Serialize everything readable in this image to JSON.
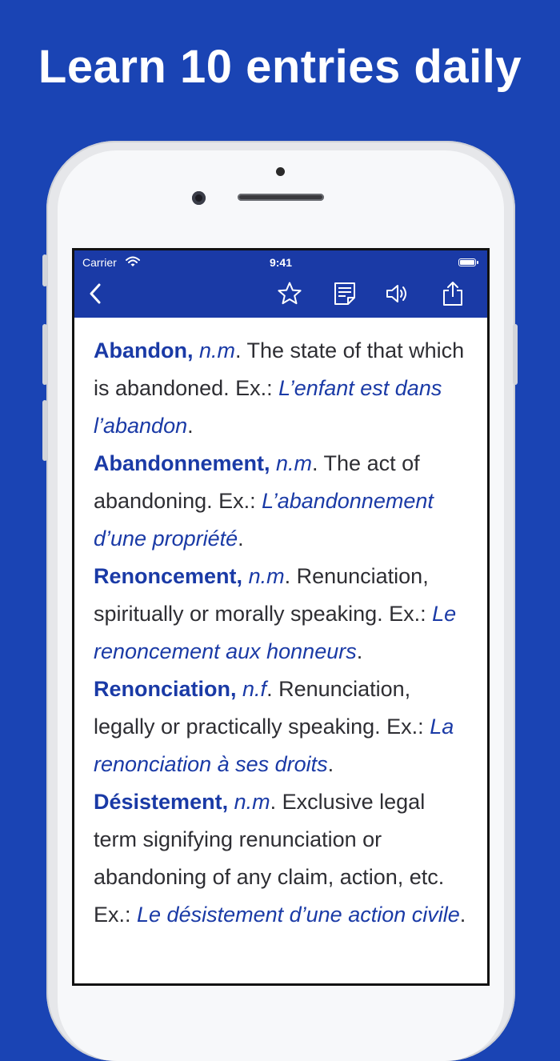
{
  "promo": {
    "headline": "Learn 10 entries daily"
  },
  "status_bar": {
    "carrier": "Carrier",
    "time": "9:41"
  },
  "toolbar": {
    "icons": [
      "back-chevron-icon",
      "star-icon",
      "note-icon",
      "speaker-icon",
      "share-icon"
    ]
  },
  "entries": [
    {
      "term": "Abandon,",
      "pos": "n.m",
      "definition": ". The state of that which is abandoned. Ex.: ",
      "example": "L’enfant est dans l’abandon",
      "end": "."
    },
    {
      "term": "Abandonnement,",
      "pos": "n.m",
      "definition": ". The act of abandoning. Ex.: ",
      "example": "L’abandonnement d’une propriété",
      "end": "."
    },
    {
      "term": "Renoncement,",
      "pos": "n.m",
      "definition": ". Renunciation, spiritually or morally speaking. Ex.: ",
      "example": "Le renoncement aux honneurs",
      "end": "."
    },
    {
      "term": "Renonciation,",
      "pos": "n.f",
      "definition": ". Renunciation, legally or practically speaking. Ex.: ",
      "example": "La renonciation à ses droits",
      "end": "."
    },
    {
      "term": "Désistement,",
      "pos": "n.m",
      "definition": ". Exclusive legal term signifying renunciation or abandoning of any claim, action, etc. Ex.: ",
      "example": "Le désistement d’une action civile",
      "end": "."
    }
  ],
  "colors": {
    "background": "#1a44b4",
    "nav": "#1a3aa6",
    "accent": "#1a3aa6",
    "text": "#2e2e33"
  }
}
